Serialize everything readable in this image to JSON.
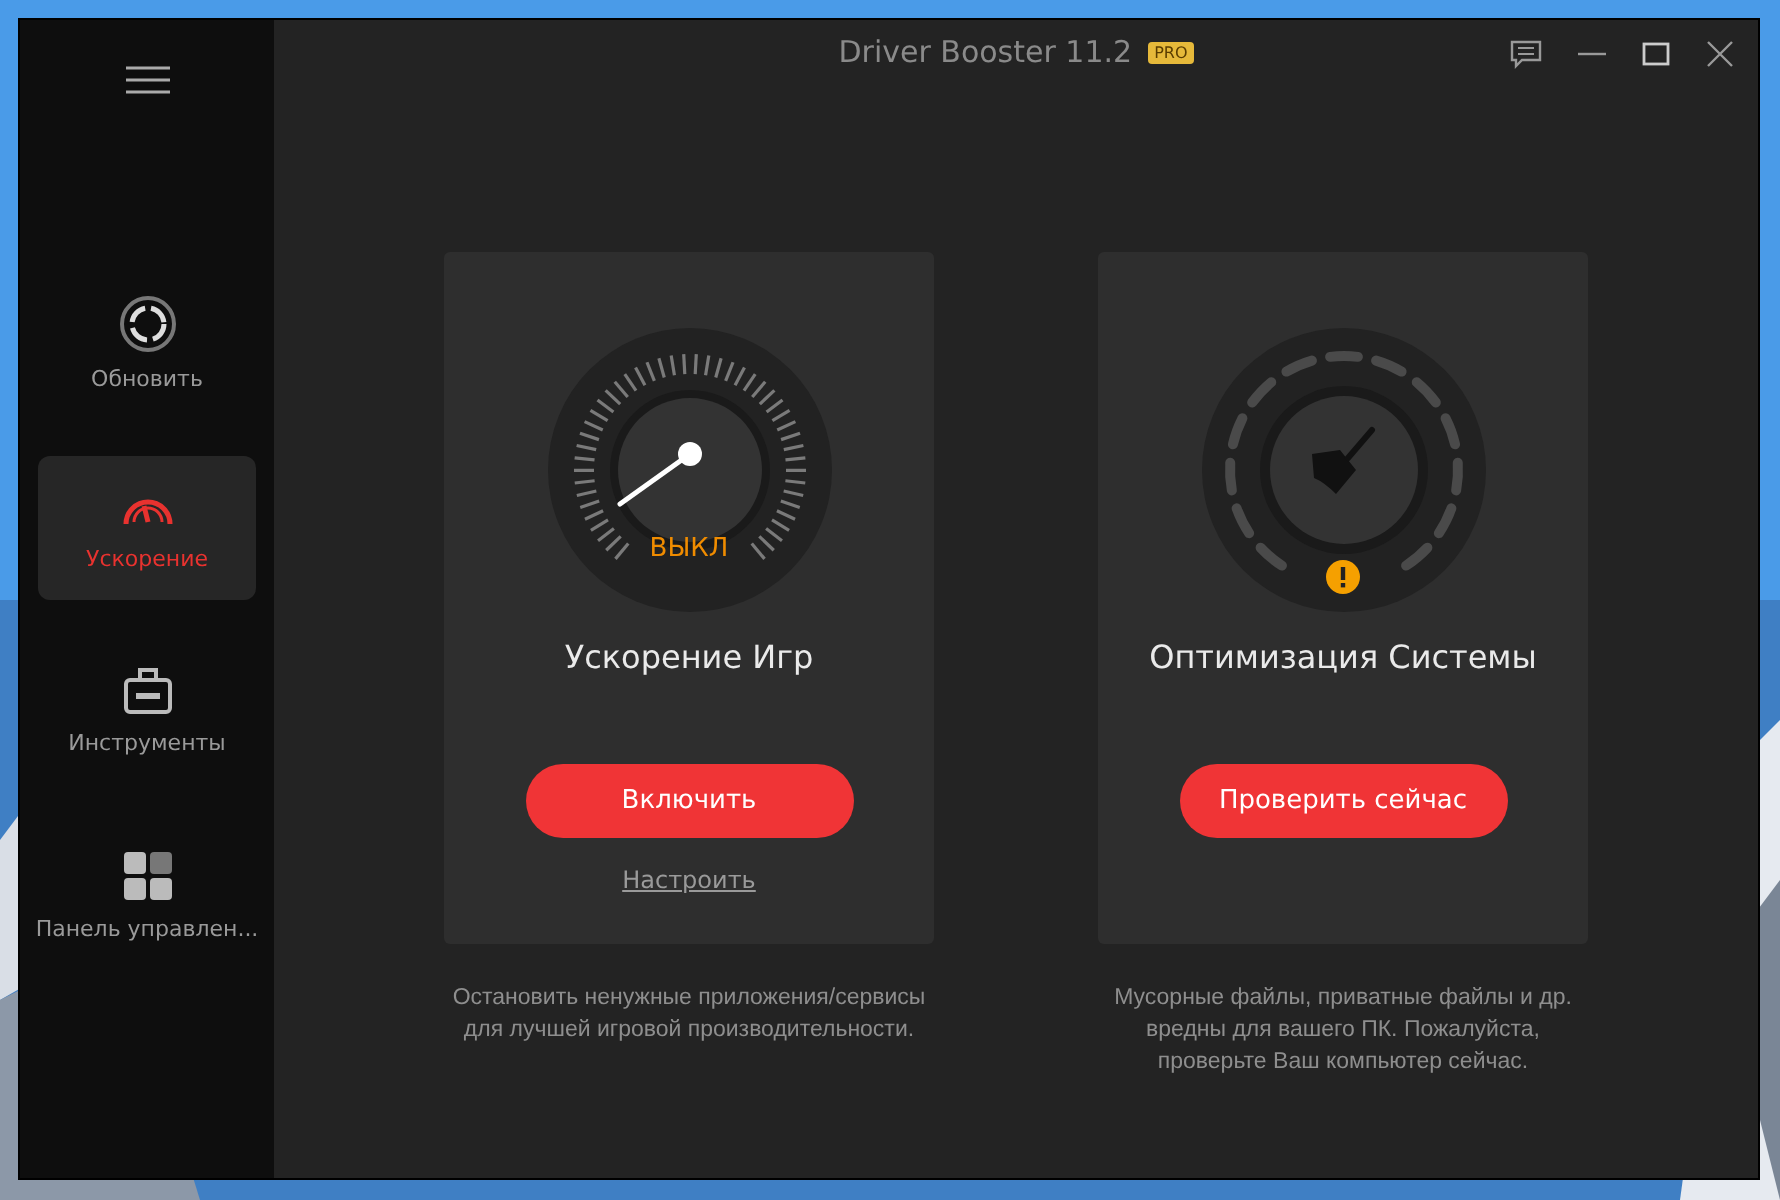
{
  "window": {
    "title": "Driver Booster 11.2",
    "badge": "PRO"
  },
  "sidebar": {
    "items": [
      {
        "kind": "update",
        "label": "Обновить",
        "selected": false
      },
      {
        "kind": "boost",
        "label": "Ускорение",
        "selected": true
      },
      {
        "kind": "tools",
        "label": "Инструменты",
        "selected": false
      },
      {
        "kind": "panel",
        "label": "Панель управлен...",
        "selected": false
      }
    ]
  },
  "cards": [
    {
      "kind": "speedometer",
      "status": "ВЫКЛ",
      "title": "Ускорение Игр",
      "button": "Включить",
      "link": "Настроить",
      "description": "Остановить ненужные приложения/сервисы\nдля лучшей игровой производительности."
    },
    {
      "kind": "cleaner",
      "warning": true,
      "title": "Оптимизация Системы",
      "button": "Проверить сейчас",
      "description": "Мусорные файлы, приватные файлы и др.\nвредны для вашего ПК. Пожалуйста,\nпроверьте Ваш компьютер сейчас."
    }
  ]
}
